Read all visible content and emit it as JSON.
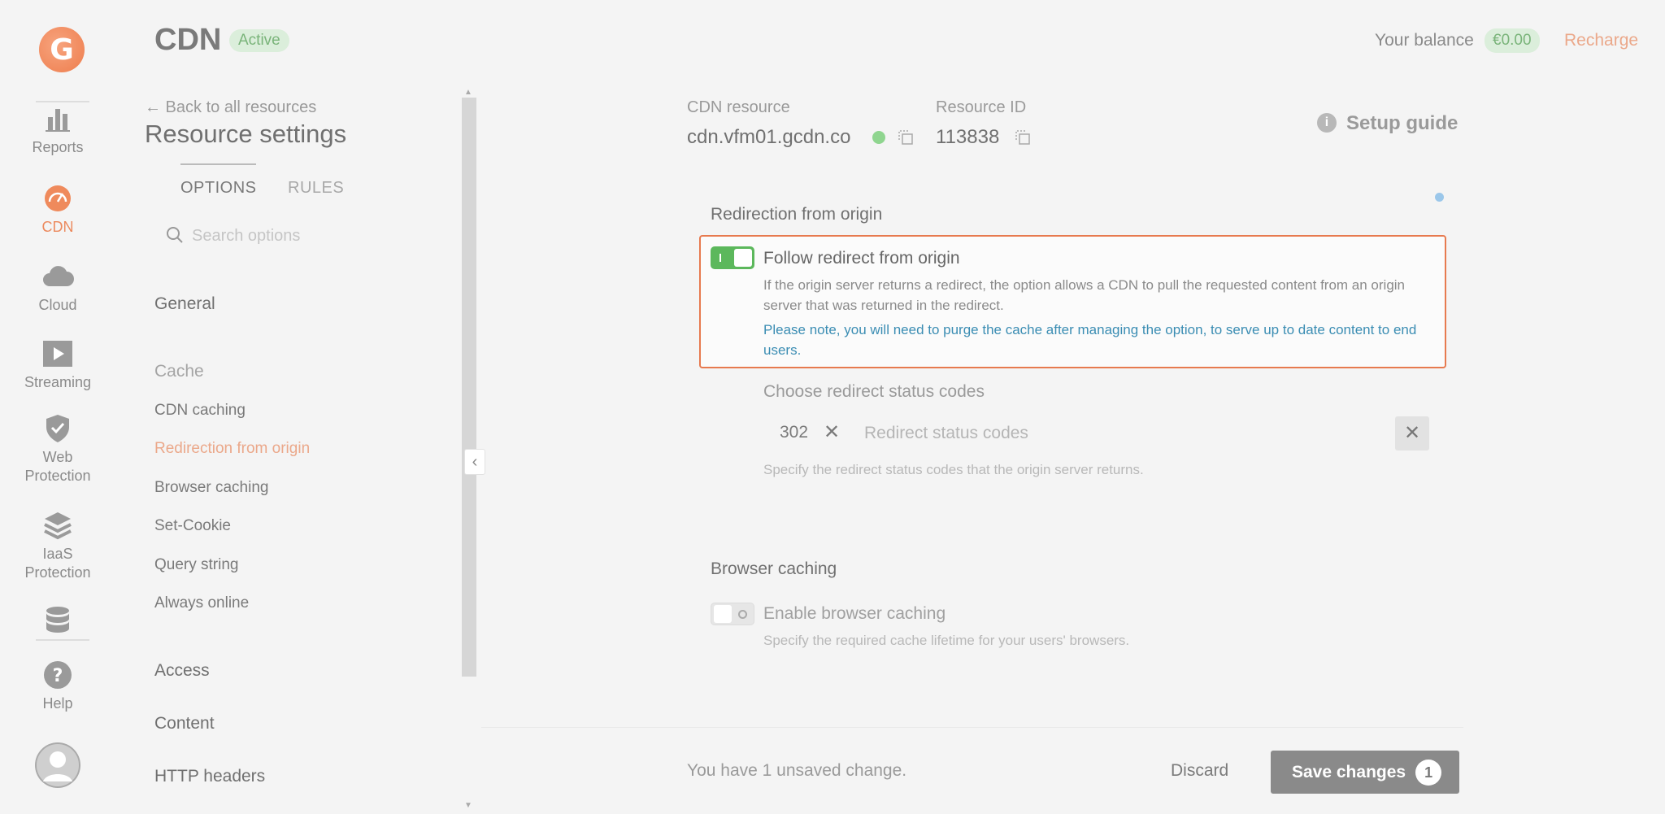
{
  "app": {
    "title": "CDN",
    "status": "Active"
  },
  "header": {
    "balance_label": "Your balance",
    "balance_value": "€0.00",
    "recharge": "Recharge"
  },
  "rail": {
    "items": [
      {
        "label": "Reports",
        "icon": "bar-chart-icon"
      },
      {
        "label": "CDN",
        "icon": "speedometer-icon"
      },
      {
        "label": "Cloud",
        "icon": "cloud-icon"
      },
      {
        "label": "Streaming",
        "icon": "play-icon"
      },
      {
        "label": "Web",
        "label2": "Protection",
        "icon": "shield-icon"
      },
      {
        "label": "IaaS",
        "label2": "Protection",
        "icon": "layers-icon"
      },
      {
        "label": "",
        "icon": "database-icon"
      },
      {
        "label": "Help",
        "icon": "help-icon"
      }
    ]
  },
  "sidebar": {
    "back": "← Back to all resources",
    "title": "Resource settings",
    "tabs": [
      "OPTIONS",
      "RULES"
    ],
    "search_placeholder": "Search options",
    "groups": {
      "general": "General",
      "cache": "Cache",
      "access": "Access",
      "content": "Content",
      "http_headers": "HTTP headers"
    },
    "cache_items": [
      "CDN caching",
      "Redirection from origin",
      "Browser caching",
      "Set-Cookie",
      "Query string",
      "Always online"
    ]
  },
  "resource": {
    "cdn_label": "CDN resource",
    "cdn_value": "cdn.vfm01.gcdn.co",
    "id_label": "Resource ID",
    "id_value": "113838",
    "setup_guide": "Setup guide"
  },
  "redirection": {
    "section_title": "Redirection from origin",
    "option_title": "Follow redirect from origin",
    "enabled": true,
    "description": "If the origin server returns a redirect, the option allows a CDN to pull the requested content from an origin server that was returned in the redirect.",
    "note": "Please note, you will need to purge the cache after managing the option, to serve up to date content to end users.",
    "codes_label": "Choose redirect status codes",
    "selected_code": "302",
    "codes_placeholder": "Redirect status codes",
    "codes_hint": "Specify the redirect status codes that the origin server returns."
  },
  "browser_caching": {
    "section_title": "Browser caching",
    "option_title": "Enable browser caching",
    "enabled": false,
    "description": "Specify the required cache lifetime for your users' browsers."
  },
  "footer": {
    "unsaved": "You have 1 unsaved change.",
    "discard": "Discard",
    "save": "Save changes",
    "save_count": "1"
  },
  "colors": {
    "accent": "#ee7d4d",
    "success": "#5cb85c",
    "note": "#3b8db3",
    "highlight_border": "#e77a4f"
  }
}
